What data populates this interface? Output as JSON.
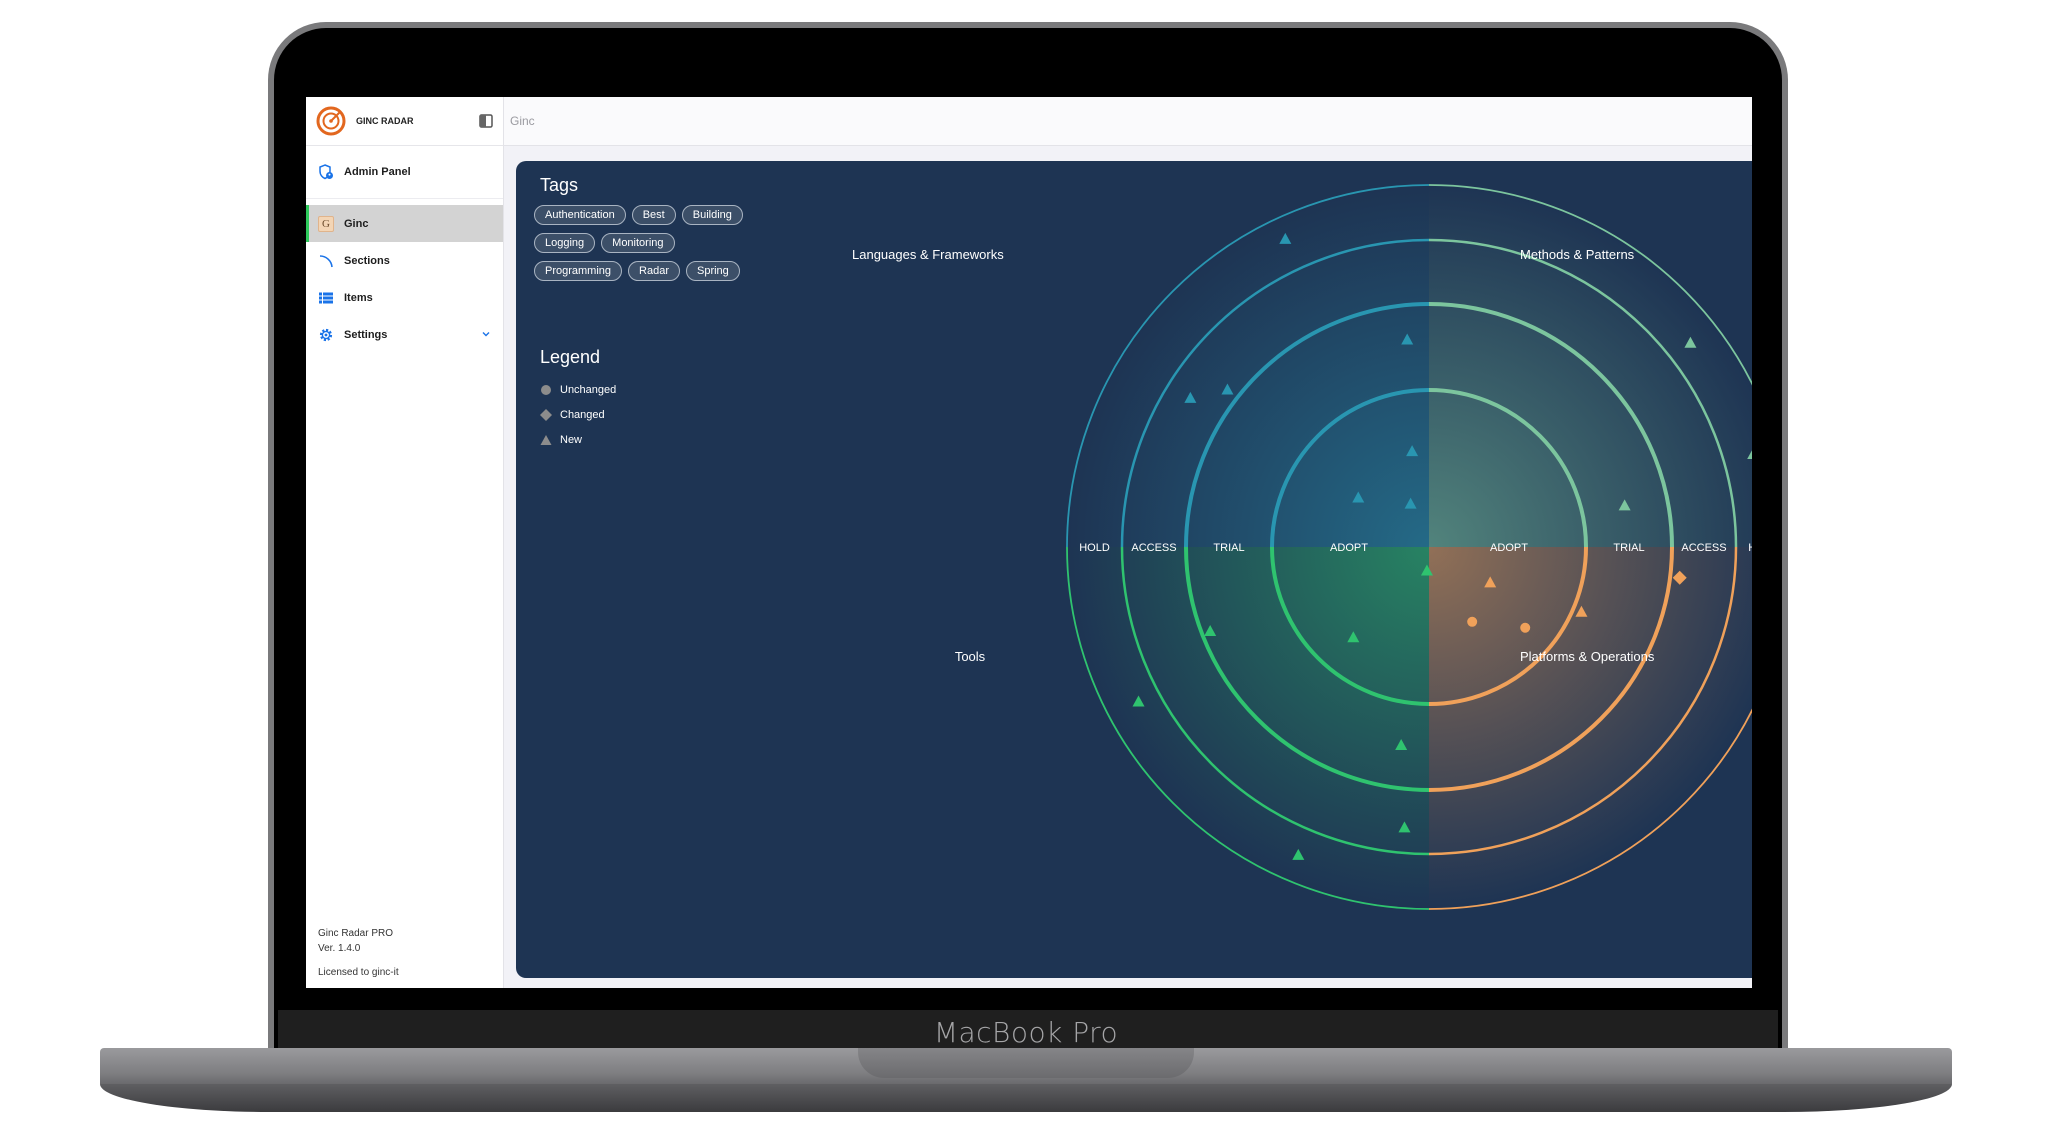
{
  "device": {
    "label": "MacBook Pro"
  },
  "sidebar": {
    "brand": "GINC RADAR",
    "admin": {
      "label": "Admin Panel"
    },
    "items": [
      {
        "label": "Ginc",
        "icon": "G",
        "active": true
      },
      {
        "label": "Sections",
        "icon": "arc-icon"
      },
      {
        "label": "Items",
        "icon": "list-icon"
      },
      {
        "label": "Settings",
        "icon": "gear-icon",
        "expandable": true
      }
    ],
    "footer": {
      "product": "Ginc Radar PRO",
      "version": "Ver. 1.4.0",
      "license": "Licensed to ginc-it"
    }
  },
  "topbar": {
    "breadcrumb": "Ginc"
  },
  "tags": {
    "title": "Tags",
    "items": [
      "Authentication",
      "Best",
      "Building",
      "Logging",
      "Monitoring",
      "Programming",
      "Radar",
      "Spring"
    ]
  },
  "legend": {
    "title": "Legend",
    "items": [
      {
        "label": "Unchanged",
        "shape": "circle"
      },
      {
        "label": "Changed",
        "shape": "diamond"
      },
      {
        "label": "New",
        "shape": "triangle"
      }
    ]
  },
  "radar": {
    "rings": [
      "ADOPT",
      "TRIAL",
      "ACCESS",
      "HOLD"
    ],
    "quadrants": [
      {
        "name": "Languages & Frameworks",
        "position": "top-left",
        "color": "#2996b1"
      },
      {
        "name": "Methods & Patterns",
        "position": "top-right",
        "color": "#7cc59e"
      },
      {
        "name": "Tools",
        "position": "bottom-left",
        "color": "#2fc36f"
      },
      {
        "name": "Platforms & Operations",
        "position": "bottom-right",
        "color": "#f0a15a"
      }
    ],
    "blips": [
      {
        "q": 0,
        "ring": 0,
        "angle": 100,
        "dist": 0.62,
        "shape": "triangle"
      },
      {
        "q": 0,
        "ring": 0,
        "angle": 145,
        "dist": 0.55,
        "shape": "triangle"
      },
      {
        "q": 0,
        "ring": 0,
        "angle": 113,
        "dist": 0.3,
        "shape": "triangle"
      },
      {
        "q": 0,
        "ring": 1,
        "angle": 96,
        "dist": 0.6,
        "shape": "triangle"
      },
      {
        "q": 0,
        "ring": 2,
        "angle": 142,
        "dist": 0.2,
        "shape": "triangle"
      },
      {
        "q": 0,
        "ring": 2,
        "angle": 148,
        "dist": 0.6,
        "shape": "triangle"
      },
      {
        "q": 0,
        "ring": 3,
        "angle": 115,
        "dist": 0.6,
        "shape": "triangle"
      },
      {
        "q": 1,
        "ring": 1,
        "angle": 12,
        "dist": 0.5,
        "shape": "triangle"
      },
      {
        "q": 1,
        "ring": 3,
        "angle": 38,
        "dist": 0.45,
        "shape": "triangle"
      },
      {
        "q": 1,
        "ring": 3,
        "angle": 16,
        "dist": 0.55,
        "shape": "triangle"
      },
      {
        "q": 2,
        "ring": 0,
        "angle": 265,
        "dist": 0.15,
        "shape": "triangle"
      },
      {
        "q": 2,
        "ring": 0,
        "angle": 230,
        "dist": 0.75,
        "shape": "triangle"
      },
      {
        "q": 2,
        "ring": 1,
        "angle": 262,
        "dist": 0.5,
        "shape": "triangle"
      },
      {
        "q": 2,
        "ring": 1,
        "angle": 201,
        "dist": 0.9,
        "shape": "triangle"
      },
      {
        "q": 2,
        "ring": 2,
        "angle": 265,
        "dist": 0.6,
        "shape": "triangle"
      },
      {
        "q": 2,
        "ring": 3,
        "angle": 208,
        "dist": 0.4,
        "shape": "triangle"
      },
      {
        "q": 2,
        "ring": 3,
        "angle": 247,
        "dist": 0.5,
        "shape": "triangle"
      },
      {
        "q": 3,
        "ring": 0,
        "angle": 330,
        "dist": 0.45,
        "shape": "triangle"
      },
      {
        "q": 3,
        "ring": 0,
        "angle": 300,
        "dist": 0.55,
        "shape": "circle"
      },
      {
        "q": 3,
        "ring": 0,
        "angle": 320,
        "dist": 0.8,
        "shape": "circle"
      },
      {
        "q": 3,
        "ring": 1,
        "angle": 337,
        "dist": 0.1,
        "shape": "triangle"
      },
      {
        "q": 3,
        "ring": 2,
        "angle": 353,
        "dist": 0.15,
        "shape": "diamond"
      }
    ]
  }
}
